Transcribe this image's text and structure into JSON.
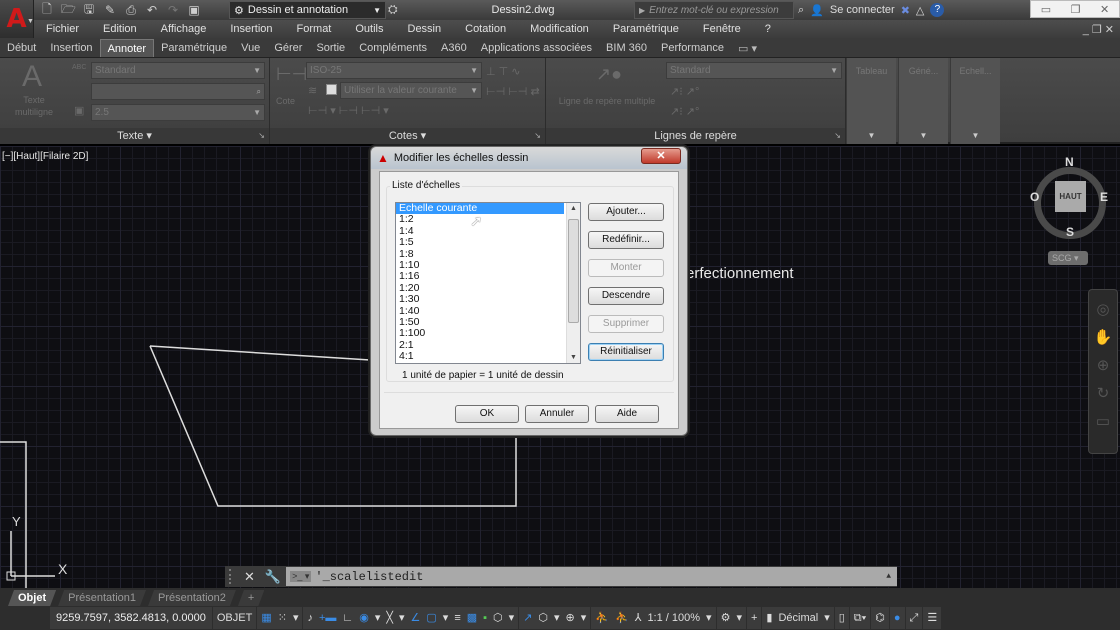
{
  "titlebar": {
    "workspace": "Dessin et annotation",
    "document_title": "Dessin2.dwg",
    "search_placeholder": "Entrez mot-clé ou expression",
    "sign_in": "Se connecter",
    "qat_icons": [
      "new-icon",
      "open-icon",
      "save-icon",
      "save-as-icon",
      "print-icon",
      "undo-icon",
      "redo-icon",
      "plot-icon"
    ]
  },
  "menubar": {
    "items": [
      "Fichier",
      "Edition",
      "Affichage",
      "Insertion",
      "Format",
      "Outils",
      "Dessin",
      "Cotation",
      "Modification",
      "Paramétrique",
      "Fenêtre",
      "?"
    ]
  },
  "ribbon_tabs": {
    "items": [
      "Début",
      "Insertion",
      "Annoter",
      "Paramétrique",
      "Vue",
      "Gérer",
      "Sortie",
      "Compléments",
      "A360",
      "Applications associées",
      "BIM 360",
      "Performance"
    ],
    "active": "Annoter"
  },
  "ribbon": {
    "texte": {
      "title": "Texte",
      "big_button": "Texte multiligne",
      "style": "Standard",
      "find_value": "",
      "height": "2.5"
    },
    "cotes": {
      "title": "Cotes",
      "big_button": "Cote",
      "style": "ISO-25",
      "layer": "Utiliser la valeur courante"
    },
    "lignes": {
      "title": "Lignes de repère",
      "big_button": "Ligne de repère multiple",
      "style": "Standard"
    },
    "collapsed": [
      "Tableau",
      "Géné...",
      "Echell..."
    ]
  },
  "viewport": {
    "label": "[−][Haut][Filaire 2D]",
    "background_text": "erfectionnement",
    "viewcube": {
      "top": "HAUT",
      "n": "N",
      "s": "S",
      "e": "E",
      "w": "O",
      "ucs": "SCG"
    },
    "axis_x": "X",
    "axis_y": "Y"
  },
  "dialog": {
    "title": "Modifier les échelles dessin",
    "group_label": "Liste d'échelles",
    "scales": [
      "Echelle courante",
      "1:2",
      "1:4",
      "1:5",
      "1:8",
      "1:10",
      "1:16",
      "1:20",
      "1:30",
      "1:40",
      "1:50",
      "1:100",
      "2:1",
      "4:1"
    ],
    "selected_index": 0,
    "unit_info": "1 unité de papier = 1 unité de dessin",
    "buttons": {
      "add": "Ajouter...",
      "redefine": "Redéfinir...",
      "up": "Monter",
      "down": "Descendre",
      "delete": "Supprimer",
      "reset": "Réinitialiser",
      "ok": "OK",
      "cancel": "Annuler",
      "help": "Aide"
    },
    "close": "✕"
  },
  "command_line": {
    "value": "'_scalelistedit"
  },
  "layout_tabs": {
    "items": [
      "Objet",
      "Présentation1",
      "Présentation2"
    ],
    "active": "Objet",
    "add": "+"
  },
  "statusbar": {
    "coords": "9259.7597, 3582.4813, 0.0000",
    "mode": "OBJET",
    "scale": "1:1 / 100%",
    "units": "Décimal"
  }
}
